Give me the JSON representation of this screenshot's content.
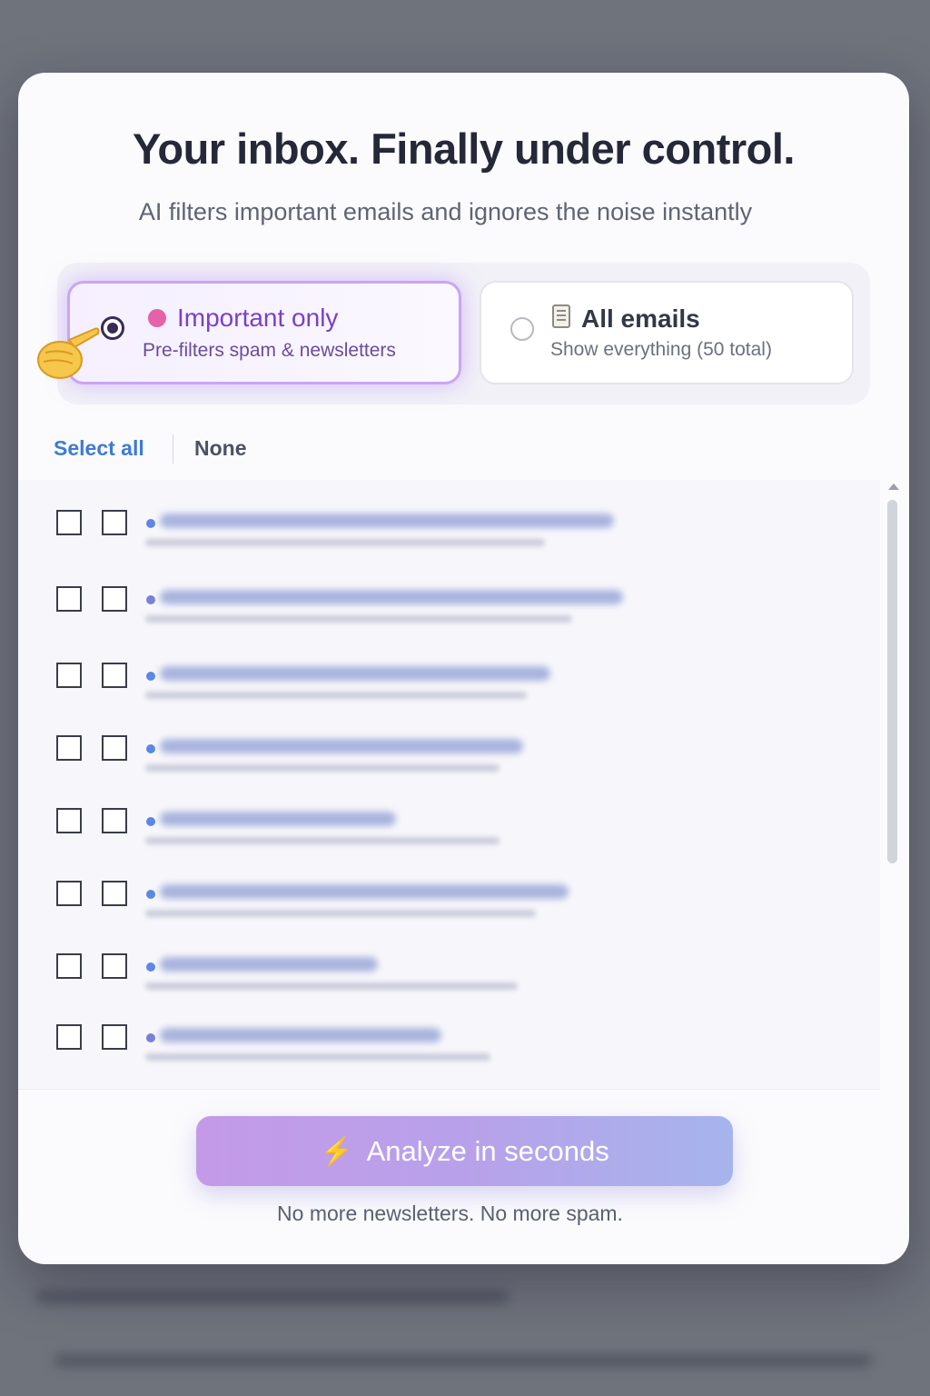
{
  "modal": {
    "title": "Your inbox. Finally under control.",
    "subtitle": "AI filters important emails and ignores the noise instantly"
  },
  "filter_options": [
    {
      "label": "Important only",
      "description": "Pre-filters spam & newsletters",
      "selected": true,
      "icon": "pink-dot-icon"
    },
    {
      "label": "All emails",
      "description": "Show everything (50 total)",
      "selected": false,
      "icon": "memo-icon"
    }
  ],
  "selection": {
    "select_all": "Select all",
    "none": "None"
  },
  "email_list": {
    "rows_visible": 8,
    "content": "blurred"
  },
  "action": {
    "button_label": "Analyze in seconds",
    "button_icon": "lightning-bolt-icon",
    "tagline": "No more newsletters. No more spam."
  },
  "colors": {
    "accent_purple": "#7b3fc8",
    "link_blue": "#3e7bd6",
    "pink_dot": "#e462a8",
    "button_gradient_start": "#c49ae8",
    "button_gradient_end": "#a6b4ec"
  }
}
